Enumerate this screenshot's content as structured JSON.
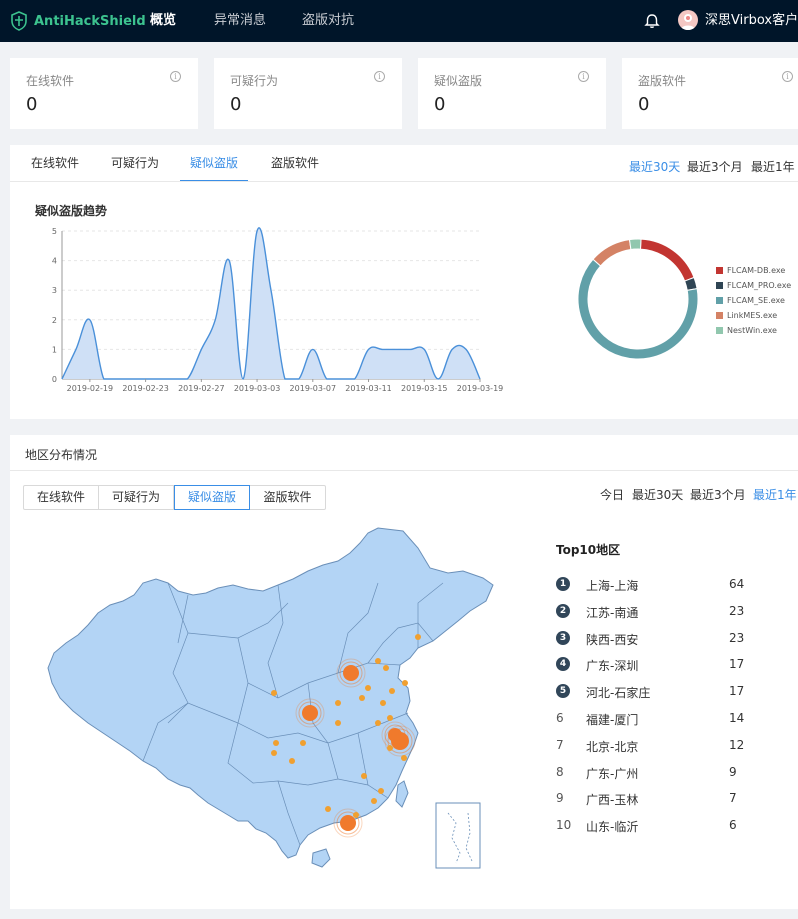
{
  "app": {
    "logo_text": "AntiHackShield"
  },
  "nav": {
    "items": [
      {
        "label": "概览"
      },
      {
        "label": "异常消息"
      },
      {
        "label": "盗版对抗"
      }
    ]
  },
  "user": {
    "name": "深思Virbox客户端"
  },
  "cards": [
    {
      "title": "在线软件",
      "value": "0"
    },
    {
      "title": "可疑行为",
      "value": "0"
    },
    {
      "title": "疑似盗版",
      "value": "0"
    },
    {
      "title": "盗版软件",
      "value": "0"
    }
  ],
  "trend": {
    "tabs": [
      {
        "label": "在线软件"
      },
      {
        "label": "可疑行为"
      },
      {
        "label": "疑似盗版"
      },
      {
        "label": "盗版软件"
      }
    ],
    "ranges": [
      {
        "label": "最近30天"
      },
      {
        "label": "最近3个月"
      },
      {
        "label": "最近1年"
      }
    ],
    "chart_title": "疑似盗版趋势"
  },
  "chart_data": [
    {
      "type": "area",
      "title": "疑似盗版趋势",
      "x": [
        "2019-02-17",
        "2019-02-18",
        "2019-02-19",
        "2019-02-20",
        "2019-02-21",
        "2019-02-22",
        "2019-02-23",
        "2019-02-24",
        "2019-02-25",
        "2019-02-26",
        "2019-02-27",
        "2019-02-28",
        "2019-03-01",
        "2019-03-02",
        "2019-03-03",
        "2019-03-04",
        "2019-03-05",
        "2019-03-06",
        "2019-03-07",
        "2019-03-08",
        "2019-03-09",
        "2019-03-10",
        "2019-03-11",
        "2019-03-12",
        "2019-03-13",
        "2019-03-14",
        "2019-03-15",
        "2019-03-16",
        "2019-03-17",
        "2019-03-18",
        "2019-03-19"
      ],
      "values": [
        0,
        1,
        2,
        0,
        0,
        0,
        0,
        0,
        0,
        0,
        1,
        2,
        4,
        0,
        5,
        3,
        0,
        0,
        1,
        0,
        0,
        0,
        1,
        1,
        1,
        1,
        1,
        0,
        1,
        1,
        0
      ],
      "x_tick_labels": [
        "2019-02-19",
        "2019-02-23",
        "2019-02-27",
        "2019-03-03",
        "2019-03-07",
        "2019-03-11",
        "2019-03-15",
        "2019-03-19"
      ],
      "y_tick_labels": [
        "0",
        "1",
        "2",
        "3",
        "4",
        "5"
      ],
      "ylim": [
        0,
        5
      ],
      "grid": true,
      "color": "#4a90d9"
    },
    {
      "type": "pie",
      "donut": true,
      "labels": [
        "FLCAM-DB.exe",
        "FLCAM_PRO.exe",
        "FLCAM_SE.exe",
        "LinkMES.exe",
        "NestWin.exe"
      ],
      "values": [
        18,
        3,
        63,
        11,
        3
      ],
      "colors": [
        "#c23531",
        "#2f4554",
        "#61a0a8",
        "#d48265",
        "#91c7ae"
      ],
      "legend_position": "right"
    }
  ],
  "region": {
    "title": "地区分布情况",
    "tabs": [
      {
        "label": "在线软件"
      },
      {
        "label": "可疑行为"
      },
      {
        "label": "疑似盗版"
      },
      {
        "label": "盗版软件"
      }
    ],
    "ranges": [
      {
        "label": "今日"
      },
      {
        "label": "最近30天"
      },
      {
        "label": "最近3个月"
      },
      {
        "label": "最近1年"
      }
    ],
    "top10_title": "Top10地区",
    "top10": [
      {
        "rank": "1",
        "name": "上海-上海",
        "value": "64"
      },
      {
        "rank": "2",
        "name": "江苏-南通",
        "value": "23"
      },
      {
        "rank": "3",
        "name": "陕西-西安",
        "value": "23"
      },
      {
        "rank": "4",
        "name": "广东-深圳",
        "value": "17"
      },
      {
        "rank": "5",
        "name": "河北-石家庄",
        "value": "17"
      },
      {
        "rank": "6",
        "name": "福建-厦门",
        "value": "14"
      },
      {
        "rank": "7",
        "name": "北京-北京",
        "value": "12"
      },
      {
        "rank": "8",
        "name": "广东-广州",
        "value": "9"
      },
      {
        "rank": "9",
        "name": "广西-玉林",
        "value": "7"
      },
      {
        "rank": "10",
        "name": "山东-临沂",
        "value": "6"
      }
    ],
    "map_colors": {
      "land": "#b3d4f5",
      "border": "#6a8fb8",
      "hotspot": "#f07a2c",
      "dot": "#f0a030"
    }
  },
  "colors": {
    "accent": "#3a8ee6",
    "topbar": "#001529",
    "brand": "#3cc38f"
  },
  "icons": {
    "logo": "shield-icon",
    "bell": "bell-icon",
    "info": "info-icon"
  }
}
